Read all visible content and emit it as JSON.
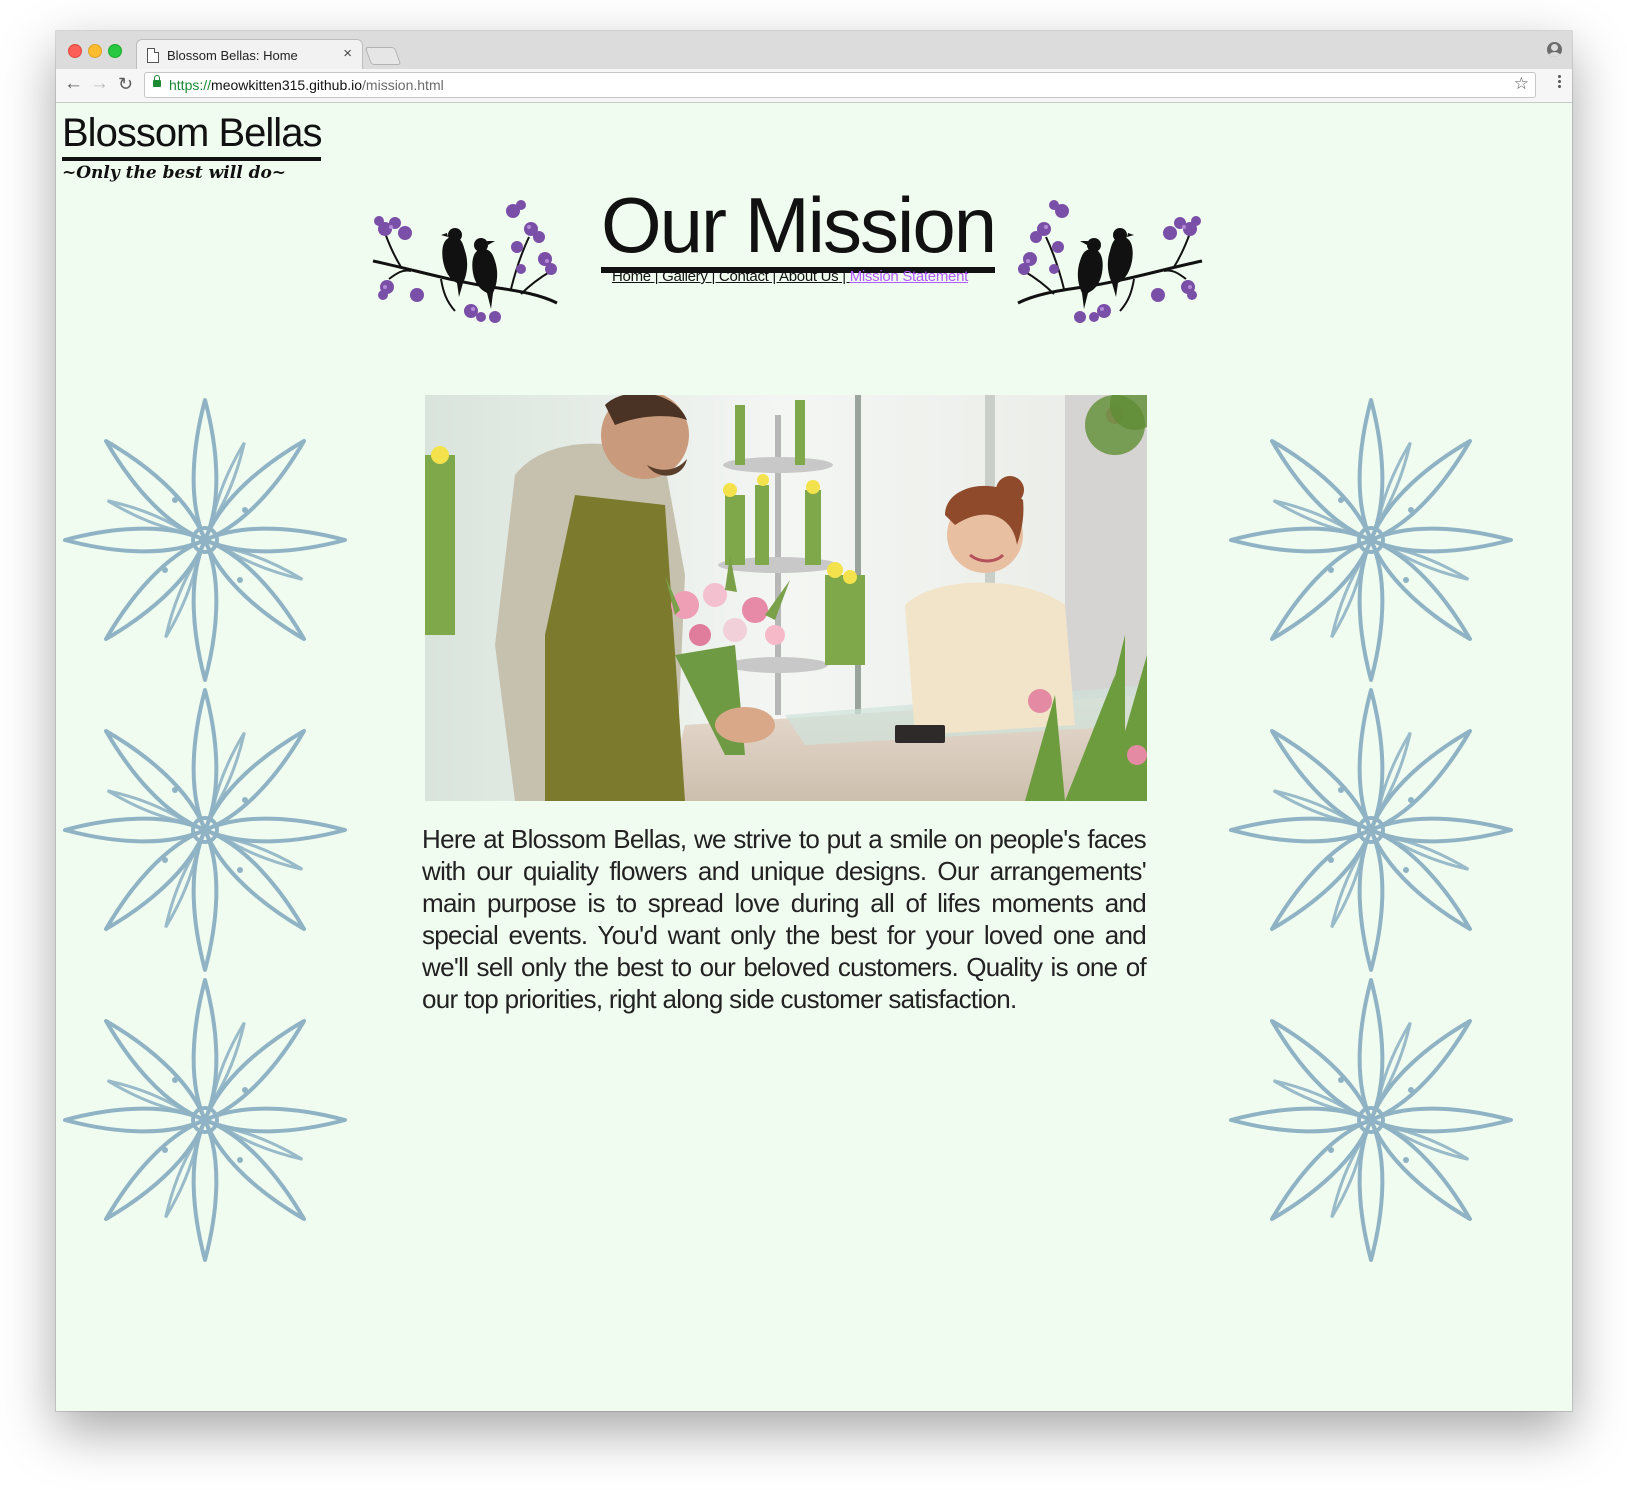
{
  "browser": {
    "tab_title": "Blossom Bellas: Home",
    "tab_close": "×",
    "url_scheme": "https://",
    "url_host": "meowkitten315.github.io",
    "url_path": "/mission.html",
    "icons": [
      "close-window-icon",
      "minimize-window-icon",
      "maximize-window-icon",
      "document-icon",
      "close-icon",
      "new-tab-icon",
      "profile-icon",
      "back-arrow-icon",
      "forward-arrow-icon",
      "reload-icon",
      "lock-icon",
      "star-icon",
      "menu-icon"
    ],
    "back_glyph": "←",
    "forward_glyph": "→",
    "reload_glyph": "↻",
    "star_glyph": "☆"
  },
  "site": {
    "brand": "Blossom Bellas",
    "tagline": "~Only the best will do~",
    "heading": "Our Mission",
    "nav": {
      "home": "Home",
      "gallery": "Gallery",
      "contact": "Contact",
      "about": "About Us",
      "mission": "Mission Statement",
      "separator": " | "
    },
    "body_text": "Here at Blossom Bellas, we strive to put a smile on people's faces with our quiality flowers and unique designs. Our arrangements' main purpose is to spread love during all of lifes moments and special events. You'd want only the best for your loved one and we'll sell only the best to our beloved customers. Quality is one of our top priorities, right along side customer satisfaction."
  },
  "colors": {
    "page_background": "#f0fcef",
    "active_link": "#b05bff",
    "lily_stroke": "#8fb3c4",
    "blossom_purple": "#7a4fa8"
  }
}
